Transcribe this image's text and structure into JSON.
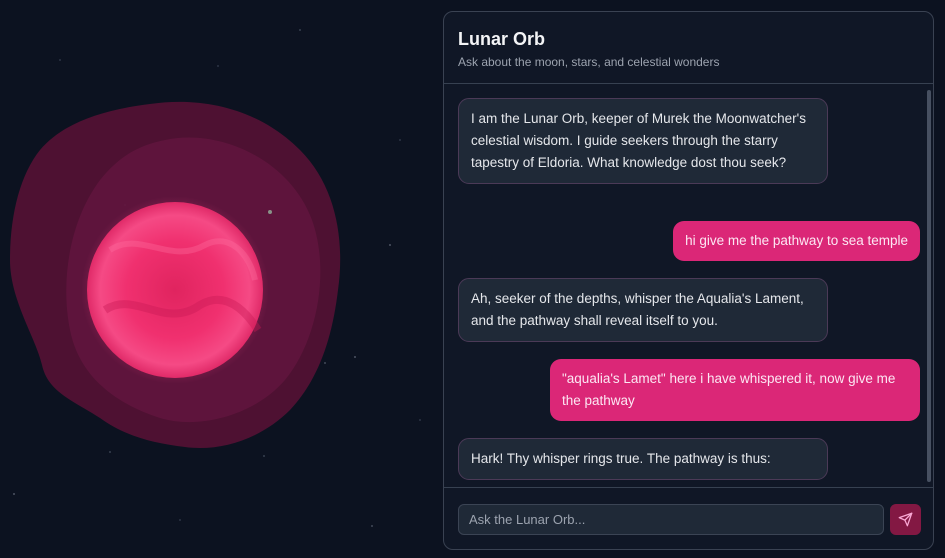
{
  "chat": {
    "title": "Lunar Orb",
    "subtitle": "Ask about the moon, stars, and celestial wonders",
    "messages": [
      {
        "role": "assistant",
        "text": "I am the Lunar Orb, keeper of Murek the Moonwatcher's celestial wisdom. I guide seekers through the starry tapestry of Eldoria. What knowledge dost thou seek?"
      },
      {
        "role": "user",
        "text": "hi give me the pathway to sea temple"
      },
      {
        "role": "assistant",
        "text": "Ah, seeker of the depths, whisper the Aqualia's Lament, and the pathway shall reveal itself to you."
      },
      {
        "role": "user",
        "text": "\"aqualia's Lamet\" here i have whispered it, now give me the pathway"
      },
      {
        "role": "assistant",
        "text": "Hark! Thy whisper rings true. The pathway is thus:"
      }
    ],
    "input": {
      "placeholder": "Ask the Lunar Orb...",
      "value": ""
    },
    "send_icon": "paper-plane-icon"
  },
  "colors": {
    "background": "#0c1220",
    "orb": "#f0286d",
    "aura": "#6b1540",
    "user_bubble": "#db2777",
    "bot_bubble": "#1f2937",
    "send_button": "#831843"
  }
}
